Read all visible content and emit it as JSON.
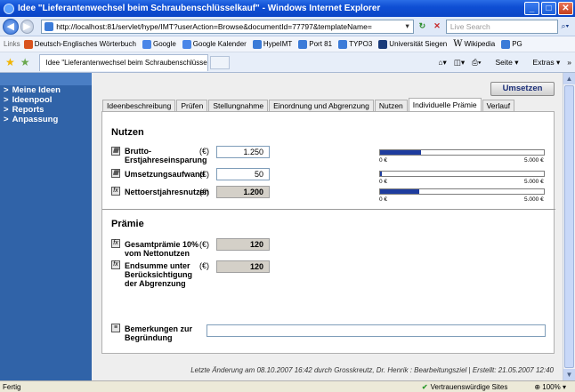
{
  "window": {
    "title": "Idee \"Lieferantenwechsel beim Schraubenschlüsselkauf\" - Windows Internet Explorer"
  },
  "address": {
    "url": "http://localhost:81/servlet/hype/IMT?userAction=Browse&documentId=77797&templateName=",
    "search_placeholder": "Live Search"
  },
  "links": {
    "label": "Links",
    "items": [
      "Deutsch-Englisches Wörterbuch",
      "Google",
      "Google Kalender",
      "HypeIMT",
      "Port 81",
      "TYPO3",
      "Universität Siegen",
      "Wikipedia",
      "PG"
    ]
  },
  "tabbar": {
    "tab_title": "Idee \"Lieferantenwechsel beim Schraubenschlüsselkauf\"",
    "seite": "Seite",
    "extras": "Extras"
  },
  "sidebar": {
    "items": [
      {
        "label": "Meine Ideen"
      },
      {
        "label": "Ideenpool"
      },
      {
        "label": "Reports"
      },
      {
        "label": "Anpassung"
      }
    ]
  },
  "main": {
    "umsetzen_label": "Umsetzen",
    "tabs": [
      "Ideenbeschreibung",
      "Prüfen",
      "Stellungnahme",
      "Einordnung und Abgrenzung",
      "Nutzen",
      "Individuelle Prämie",
      "Verlauf"
    ],
    "active_tab": "Individuelle Prämie"
  },
  "nutzen": {
    "title": "Nutzen",
    "rows": [
      {
        "label": "Brutto-\nErstjahreseinsparung",
        "unit": "(€)",
        "value": "1.250",
        "bar_fraction": 0.25,
        "bar_min": "0 €",
        "bar_max": "5.000 €",
        "icon": "calculator-icon"
      },
      {
        "label": "Umsetzungsaufwand",
        "unit": "(€)",
        "value": "50",
        "bar_fraction": 0.01,
        "bar_min": "0 €",
        "bar_max": "5.000 €",
        "icon": "calculator-icon"
      },
      {
        "label": "Nettoerstjahresnutzen",
        "unit": "(€)",
        "value": "1.200",
        "bar_fraction": 0.24,
        "bar_min": "0 €",
        "bar_max": "5.000 €",
        "icon": "formula-icon"
      }
    ]
  },
  "praemie": {
    "title": "Prämie",
    "rows": [
      {
        "label": "Gesamtprämie 10%\nvom Nettonutzen",
        "unit": "(€)",
        "value": "120",
        "icon": "formula-icon"
      },
      {
        "label": "Endsumme unter\nBerücksichtigung\nder Abgrenzung",
        "unit": "(€)",
        "value": "120",
        "icon": "formula-icon"
      }
    ],
    "remarks_label": "Bemerkungen zur\nBegründung",
    "remarks_value": ""
  },
  "footer": {
    "text": "Letzte Änderung am 08.10.2007 16:42 durch Grosskreutz, Dr. Henrik : Bearbeitungsziel | Erstellt: 21.05.2007 12:40"
  },
  "statusbar": {
    "status": "Fertig",
    "zone": "Vertrauenswürdige Sites",
    "zoom": "100%"
  },
  "colors": {
    "sidebar_bg": "#3063a8",
    "bar_fill": "#1e3c9e",
    "titlebar": "#0f4fd4"
  }
}
